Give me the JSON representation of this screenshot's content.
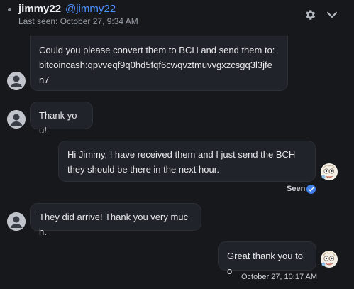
{
  "header": {
    "username": "jimmy22",
    "handle": "@jimmy22",
    "last_seen": "Last seen: October 27, 9:34 AM",
    "settings_icon": "gear-icon",
    "collapse_icon": "chevron-down-icon"
  },
  "messages": [
    {
      "from": "contact",
      "line1": "Could you please convert them to BCH and send them to:",
      "line2": "bitcoincash:qpvveqf9q0hd5fqf6cwqvztmuvvgxzcsgq3l3jfe",
      "line3": "n7"
    },
    {
      "from": "contact",
      "text": "Thank you!"
    },
    {
      "from": "me",
      "line1": "Hi Jimmy, I have received them and I just send the BCH",
      "line2": "they should be there in the next hour."
    },
    {
      "from": "contact",
      "text": "They did arrive! Thank you very much."
    },
    {
      "from": "me",
      "text": "Great thank you too"
    }
  ],
  "status": {
    "seen_label": "Seen",
    "last_timestamp": "October 27, 10:17 AM"
  },
  "colors": {
    "background": "#16181c",
    "bubble": "#202329",
    "accent": "#4c93ff",
    "muted": "#9ba1a8"
  }
}
